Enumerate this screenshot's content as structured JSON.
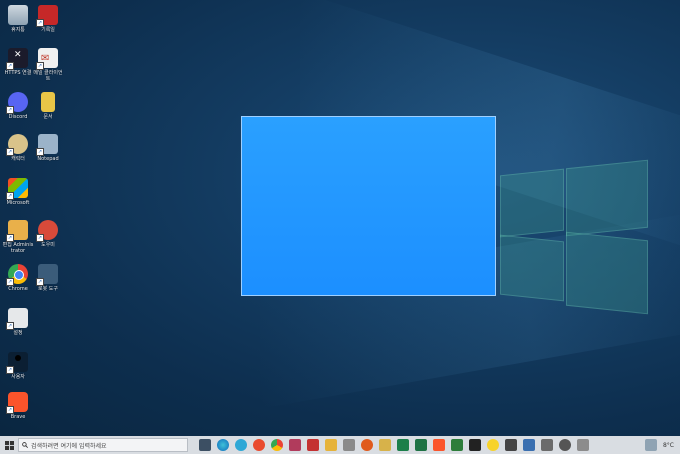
{
  "desktop": {
    "icons": [
      {
        "label": "휴지통"
      },
      {
        "label": "기록일"
      },
      {
        "label": "HTTPS 연결"
      },
      {
        "label": "메일 클라이언트"
      },
      {
        "label": "Discord"
      },
      {
        "label": "문서"
      },
      {
        "label": "캐릭터"
      },
      {
        "label": "Notepad"
      },
      {
        "label": "Microsoft"
      },
      {
        "label": "편집 Administrator"
      },
      {
        "label": "도우미"
      },
      {
        "label": "Chrome"
      },
      {
        "label": "로봇 도구"
      },
      {
        "label": "설정"
      },
      {
        "label": "사용자"
      },
      {
        "label": "Brave"
      }
    ]
  },
  "taskbar": {
    "search_placeholder": "검색하려면 여기에 입력하세요",
    "weather": "8°C"
  },
  "colors": {
    "selection": "#1c8fff",
    "taskbar": "#d9dde2",
    "desktop_bg": "#143d63"
  }
}
